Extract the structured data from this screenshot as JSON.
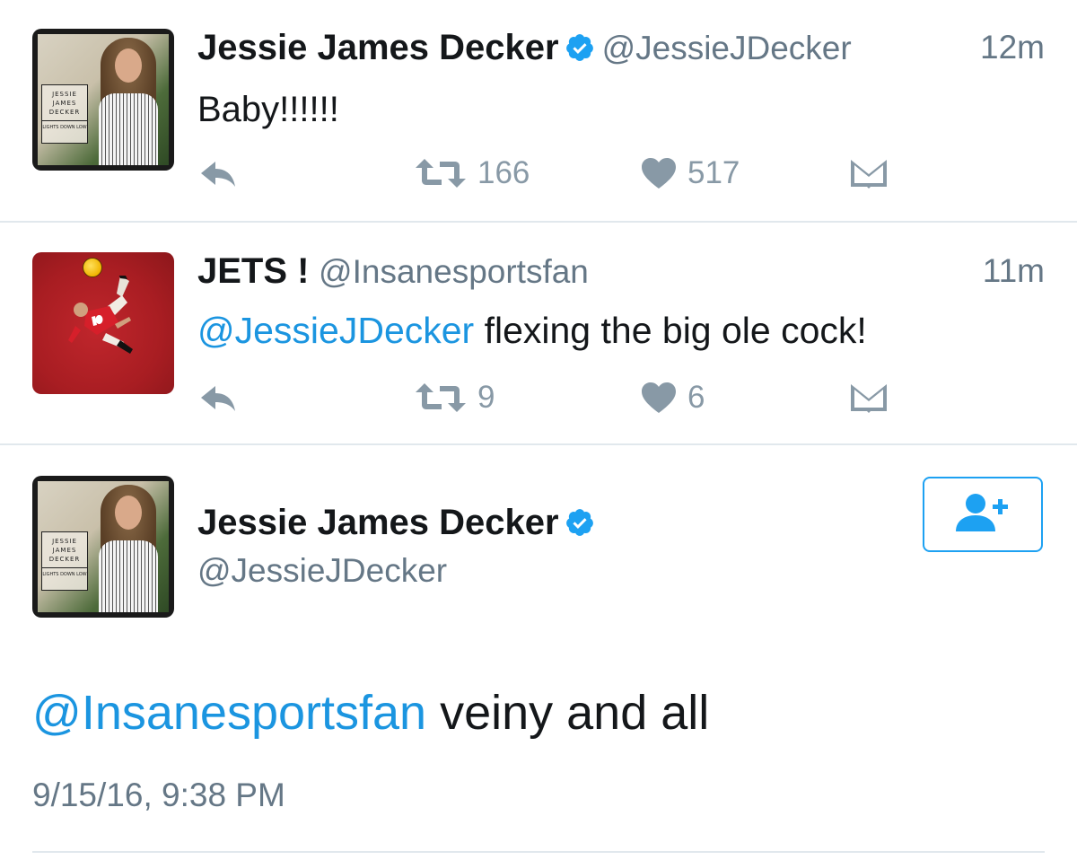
{
  "tweets": [
    {
      "name": "Jessie James Decker",
      "verified": true,
      "handle": "@JessieJDecker",
      "time": "12m",
      "mention": "",
      "text": "Baby!!!!!!",
      "retweets": "166",
      "likes": "517",
      "avatar": {
        "line1": "JESSIE",
        "line2": "JAMES",
        "line3": "DECKER",
        "line4": "LIGHTS DOWN LOW"
      }
    },
    {
      "name": "JETS !",
      "verified": false,
      "handle": "@Insanesportsfan",
      "time": "11m",
      "mention": "@JessieJDecker",
      "text": " flexing the big ole cock!",
      "retweets": "9",
      "likes": "6"
    }
  ],
  "expanded": {
    "name": "Jessie James Decker",
    "verified": true,
    "handle": "@JessieJDecker",
    "mention": "@Insanesportsfan",
    "text": " veiny and all",
    "date": "9/15/16, 9:38 PM",
    "avatar": {
      "line1": "JESSIE",
      "line2": "JAMES",
      "line3": "DECKER",
      "line4": "LIGHTS DOWN LOW"
    }
  },
  "colors": {
    "link": "#1b95e0",
    "verified": "#1da1f2",
    "muted": "#657786",
    "action": "#8899a6",
    "divider": "#e1e8ed"
  },
  "icons": [
    "reply-icon",
    "retweet-icon",
    "like-icon",
    "direct-message-icon",
    "verified-badge-icon",
    "follow-icon"
  ]
}
